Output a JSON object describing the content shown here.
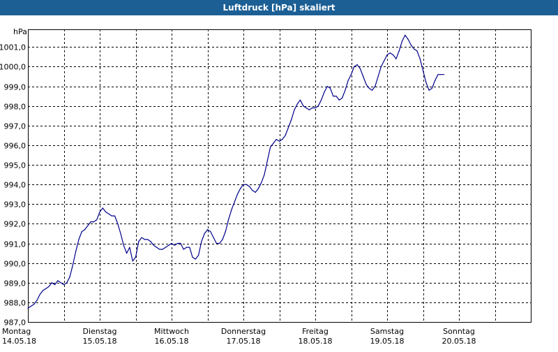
{
  "window": {
    "title": "Luftdruck [hPa] skaliert"
  },
  "chart_data": {
    "type": "line",
    "title": "Luftdruck [hPa] skaliert",
    "ylabel": "hPa",
    "ylim": [
      987.0,
      1001.9
    ],
    "yticks": [
      987.0,
      988.0,
      989.0,
      990.0,
      991.0,
      992.0,
      993.0,
      994.0,
      995.0,
      996.0,
      997.0,
      998.0,
      999.0,
      1000.0,
      1001.0
    ],
    "ytick_labels": [
      "987,0",
      "988,0",
      "989,0",
      "990,0",
      "991,0",
      "992,0",
      "993,0",
      "994,0",
      "995,0",
      "996,0",
      "997,0",
      "998,0",
      "999,0",
      "1000,0",
      "1001,0"
    ],
    "xlim": [
      "2018-05-14 00:00",
      "2018-05-21 00:00"
    ],
    "x_ticks": [
      {
        "day": "Montag",
        "date": "14.05.18"
      },
      {
        "day": "Dienstag",
        "date": "15.05.18"
      },
      {
        "day": "Mittwoch",
        "date": "16.05.18"
      },
      {
        "day": "Donnerstag",
        "date": "17.05.18"
      },
      {
        "day": "Freitag",
        "date": "18.05.18"
      },
      {
        "day": "Samstag",
        "date": "19.05.18"
      },
      {
        "day": "Sonntag",
        "date": "20.05.18"
      }
    ],
    "grid": true,
    "series": [
      {
        "color": "#00008b",
        "points": [
          [
            "2018-05-14 00:00",
            987.7
          ],
          [
            "2018-05-14 01:00",
            987.8
          ],
          [
            "2018-05-14 02:00",
            987.9
          ],
          [
            "2018-05-14 03:00",
            988.1
          ],
          [
            "2018-05-14 04:00",
            988.4
          ],
          [
            "2018-05-14 05:00",
            988.6
          ],
          [
            "2018-05-14 06:00",
            988.7
          ],
          [
            "2018-05-14 07:00",
            988.8
          ],
          [
            "2018-05-14 08:00",
            989.0
          ],
          [
            "2018-05-14 09:00",
            988.9
          ],
          [
            "2018-05-14 10:00",
            989.1
          ],
          [
            "2018-05-14 11:00",
            989.0
          ],
          [
            "2018-05-14 12:00",
            988.9
          ],
          [
            "2018-05-14 13:00",
            989.0
          ],
          [
            "2018-05-14 14:00",
            989.3
          ],
          [
            "2018-05-14 15:00",
            989.9
          ],
          [
            "2018-05-14 16:00",
            990.6
          ],
          [
            "2018-05-14 17:00",
            991.2
          ],
          [
            "2018-05-14 18:00",
            991.6
          ],
          [
            "2018-05-14 19:00",
            991.7
          ],
          [
            "2018-05-14 20:00",
            991.9
          ],
          [
            "2018-05-14 21:00",
            992.1
          ],
          [
            "2018-05-14 22:00",
            992.1
          ],
          [
            "2018-05-14 23:00",
            992.2
          ],
          [
            "2018-05-15 00:00",
            992.6
          ],
          [
            "2018-05-15 01:00",
            992.8
          ],
          [
            "2018-05-15 02:00",
            992.6
          ],
          [
            "2018-05-15 03:00",
            992.5
          ],
          [
            "2018-05-15 04:00",
            992.4
          ],
          [
            "2018-05-15 05:00",
            992.4
          ],
          [
            "2018-05-15 06:00",
            992.0
          ],
          [
            "2018-05-15 07:00",
            991.5
          ],
          [
            "2018-05-15 08:00",
            990.9
          ],
          [
            "2018-05-15 09:00",
            990.5
          ],
          [
            "2018-05-15 10:00",
            990.8
          ],
          [
            "2018-05-15 11:00",
            990.1
          ],
          [
            "2018-05-15 12:00",
            990.3
          ],
          [
            "2018-05-15 13:00",
            991.1
          ],
          [
            "2018-05-15 14:00",
            991.3
          ],
          [
            "2018-05-15 15:00",
            991.2
          ],
          [
            "2018-05-15 16:00",
            991.2
          ],
          [
            "2018-05-15 17:00",
            991.1
          ],
          [
            "2018-05-15 18:00",
            990.9
          ],
          [
            "2018-05-15 19:00",
            990.8
          ],
          [
            "2018-05-15 20:00",
            990.7
          ],
          [
            "2018-05-15 21:00",
            990.7
          ],
          [
            "2018-05-15 22:00",
            990.8
          ],
          [
            "2018-05-15 23:00",
            990.9
          ],
          [
            "2018-05-16 00:00",
            991.0
          ],
          [
            "2018-05-16 01:00",
            990.9
          ],
          [
            "2018-05-16 02:00",
            991.0
          ],
          [
            "2018-05-16 03:00",
            991.0
          ],
          [
            "2018-05-16 04:00",
            990.7
          ],
          [
            "2018-05-16 05:00",
            990.8
          ],
          [
            "2018-05-16 06:00",
            990.8
          ],
          [
            "2018-05-16 07:00",
            990.3
          ],
          [
            "2018-05-16 08:00",
            990.2
          ],
          [
            "2018-05-16 09:00",
            990.4
          ],
          [
            "2018-05-16 10:00",
            991.1
          ],
          [
            "2018-05-16 11:00",
            991.5
          ],
          [
            "2018-05-16 12:00",
            991.7
          ],
          [
            "2018-05-16 13:00",
            991.6
          ],
          [
            "2018-05-16 14:00",
            991.3
          ],
          [
            "2018-05-16 15:00",
            991.0
          ],
          [
            "2018-05-16 16:00",
            991.0
          ],
          [
            "2018-05-16 17:00",
            991.2
          ],
          [
            "2018-05-16 18:00",
            991.6
          ],
          [
            "2018-05-16 19:00",
            992.2
          ],
          [
            "2018-05-16 20:00",
            992.7
          ],
          [
            "2018-05-16 21:00",
            993.1
          ],
          [
            "2018-05-16 22:00",
            993.5
          ],
          [
            "2018-05-16 23:00",
            993.8
          ],
          [
            "2018-05-17 00:00",
            994.0
          ],
          [
            "2018-05-17 01:00",
            994.0
          ],
          [
            "2018-05-17 02:00",
            993.9
          ],
          [
            "2018-05-17 03:00",
            993.7
          ],
          [
            "2018-05-17 04:00",
            993.6
          ],
          [
            "2018-05-17 05:00",
            993.8
          ],
          [
            "2018-05-17 06:00",
            994.1
          ],
          [
            "2018-05-17 07:00",
            994.5
          ],
          [
            "2018-05-17 08:00",
            995.2
          ],
          [
            "2018-05-17 09:00",
            995.9
          ],
          [
            "2018-05-17 10:00",
            996.1
          ],
          [
            "2018-05-17 11:00",
            996.3
          ],
          [
            "2018-05-17 12:00",
            996.2
          ],
          [
            "2018-05-17 13:00",
            996.3
          ],
          [
            "2018-05-17 14:00",
            996.5
          ],
          [
            "2018-05-17 15:00",
            996.9
          ],
          [
            "2018-05-17 16:00",
            997.3
          ],
          [
            "2018-05-17 17:00",
            997.8
          ],
          [
            "2018-05-17 18:00",
            998.1
          ],
          [
            "2018-05-17 19:00",
            998.3
          ],
          [
            "2018-05-17 20:00",
            998.0
          ],
          [
            "2018-05-17 21:00",
            997.9
          ],
          [
            "2018-05-17 22:00",
            997.8
          ],
          [
            "2018-05-17 23:00",
            997.9
          ],
          [
            "2018-05-18 00:00",
            997.9
          ],
          [
            "2018-05-18 01:00",
            998.0
          ],
          [
            "2018-05-18 02:00",
            998.3
          ],
          [
            "2018-05-18 03:00",
            998.7
          ],
          [
            "2018-05-18 04:00",
            999.0
          ],
          [
            "2018-05-18 05:00",
            998.9
          ],
          [
            "2018-05-18 06:00",
            998.5
          ],
          [
            "2018-05-18 07:00",
            998.5
          ],
          [
            "2018-05-18 08:00",
            998.3
          ],
          [
            "2018-05-18 09:00",
            998.4
          ],
          [
            "2018-05-18 10:00",
            998.8
          ],
          [
            "2018-05-18 11:00",
            999.3
          ],
          [
            "2018-05-18 12:00",
            999.6
          ],
          [
            "2018-05-18 13:00",
            1000.0
          ],
          [
            "2018-05-18 14:00",
            1000.1
          ],
          [
            "2018-05-18 15:00",
            999.9
          ],
          [
            "2018-05-18 16:00",
            999.5
          ],
          [
            "2018-05-18 17:00",
            999.1
          ],
          [
            "2018-05-18 18:00",
            998.9
          ],
          [
            "2018-05-18 19:00",
            998.8
          ],
          [
            "2018-05-18 20:00",
            999.0
          ],
          [
            "2018-05-18 21:00",
            999.5
          ],
          [
            "2018-05-18 22:00",
            1000.0
          ],
          [
            "2018-05-18 23:00",
            1000.3
          ],
          [
            "2018-05-19 00:00",
            1000.6
          ],
          [
            "2018-05-19 01:00",
            1000.7
          ],
          [
            "2018-05-19 02:00",
            1000.6
          ],
          [
            "2018-05-19 03:00",
            1000.4
          ],
          [
            "2018-05-19 04:00",
            1000.8
          ],
          [
            "2018-05-19 05:00",
            1001.3
          ],
          [
            "2018-05-19 06:00",
            1001.6
          ],
          [
            "2018-05-19 07:00",
            1001.4
          ],
          [
            "2018-05-19 08:00",
            1001.1
          ],
          [
            "2018-05-19 09:00",
            1000.9
          ],
          [
            "2018-05-19 10:00",
            1000.8
          ],
          [
            "2018-05-19 11:00",
            1000.4
          ],
          [
            "2018-05-19 12:00",
            999.8
          ],
          [
            "2018-05-19 13:00",
            999.2
          ],
          [
            "2018-05-19 14:00",
            998.8
          ],
          [
            "2018-05-19 15:00",
            998.9
          ],
          [
            "2018-05-19 16:00",
            999.3
          ],
          [
            "2018-05-19 17:00",
            999.6
          ],
          [
            "2018-05-19 18:00",
            999.6
          ],
          [
            "2018-05-19 19:00",
            999.6
          ]
        ]
      }
    ]
  }
}
